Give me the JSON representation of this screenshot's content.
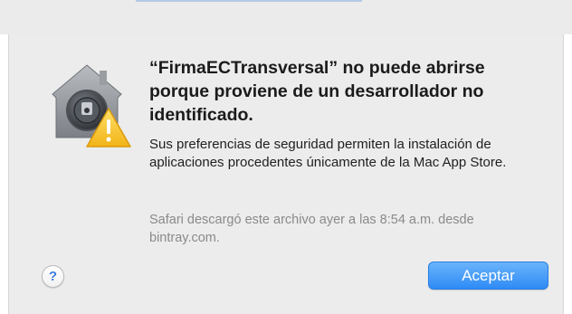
{
  "dialog": {
    "title": "“FirmaECTransversal” no puede abrirse porque proviene de un desarrollador no identificado.",
    "body": "Sus preferencias de seguridad permiten la instalación de aplicaciones procedentes únicamente de la Mac App Store.",
    "source_info": "Safari descargó este archivo ayer a las 8:54 a.m. desde bintray.com.",
    "help_label": "?",
    "accept_label": "Aceptar",
    "icon": "gatekeeper-warning-icon"
  },
  "colors": {
    "accent": "#2e8bf5",
    "dialog_bg": "#ececec",
    "warning": "#f7c32c"
  }
}
